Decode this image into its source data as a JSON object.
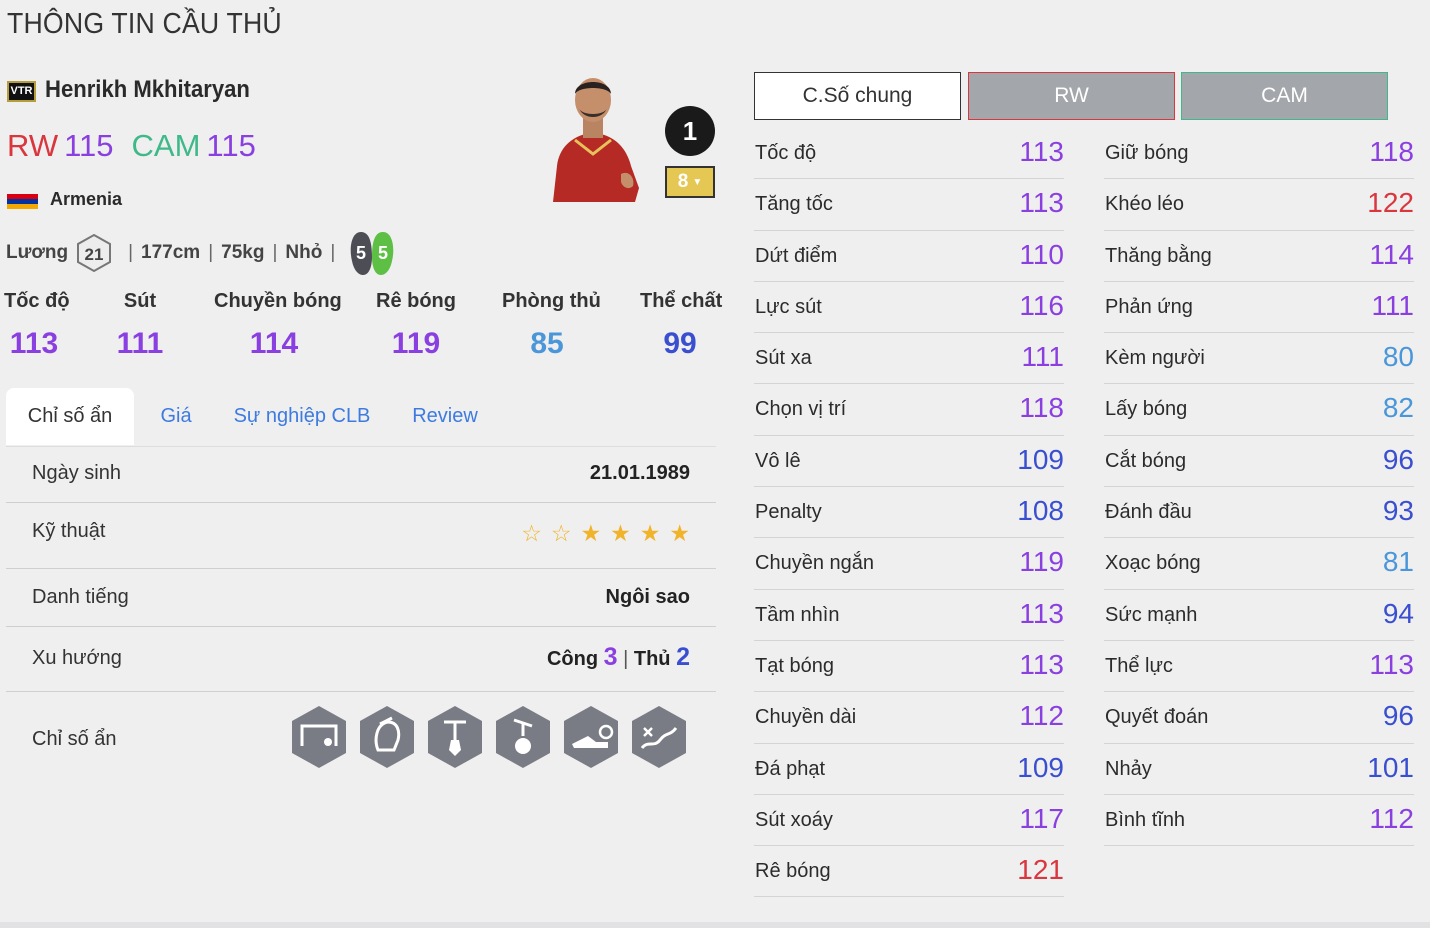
{
  "page": {
    "title": "THÔNG TIN CẦU THỦ"
  },
  "player": {
    "season": "VTR",
    "name": "Henrikh Mkhitaryan",
    "positions": [
      {
        "pos": "RW",
        "ovr": "115",
        "color": "#d9363e"
      },
      {
        "pos": "CAM",
        "ovr": "115",
        "color": "#3fb98a"
      }
    ],
    "nation": "Armenia",
    "salary_label": "Lương",
    "salary": "21",
    "height": "177cm",
    "weight": "75kg",
    "body_type": "Nhỏ",
    "left_foot": "5",
    "right_foot": "5",
    "rank": "1",
    "upgrade_level": "8"
  },
  "summary": [
    {
      "label": "Tốc độ",
      "value": "113",
      "color": "#8a3fe0"
    },
    {
      "label": "Sút",
      "value": "111",
      "color": "#8a3fe0"
    },
    {
      "label": "Chuyền bóng",
      "value": "114",
      "color": "#8a3fe0"
    },
    {
      "label": "Rê bóng",
      "value": "119",
      "color": "#8a3fe0"
    },
    {
      "label": "Phòng thủ",
      "value": "85",
      "color": "#4a96d8"
    },
    {
      "label": "Thể chất",
      "value": "99",
      "color": "#3a4fd0"
    }
  ],
  "tabs": [
    "Chỉ số ẩn",
    "Giá",
    "Sự nghiệp CLB",
    "Review"
  ],
  "details": {
    "birth_label": "Ngày sinh",
    "birth_value": "21.01.1989",
    "skill_label": "Kỹ thuật",
    "skill_stars": 4,
    "reputation_label": "Danh tiếng",
    "reputation_value": "Ngôi sao",
    "work_rate_label": "Xu hướng",
    "attack_label": "Công",
    "attack_value": "3",
    "defense_label": "Thủ",
    "defense_value": "2",
    "traits_label": "Chỉ số ẩn",
    "traits": [
      "goal-trait-icon",
      "gladiator-helmet-trait-icon",
      "tie-trait-icon",
      "puppet-ball-trait-icon",
      "boot-trait-icon",
      "route-arrows-trait-icon"
    ]
  },
  "position_buttons": [
    "C.Số chung",
    "RW",
    "CAM"
  ],
  "stats_left": [
    {
      "label": "Tốc độ",
      "value": "113",
      "color": "#8a3fe0"
    },
    {
      "label": "Tăng tốc",
      "value": "113",
      "color": "#8a3fe0"
    },
    {
      "label": "Dứt điểm",
      "value": "110",
      "color": "#8a3fe0"
    },
    {
      "label": "Lực sút",
      "value": "116",
      "color": "#8a3fe0"
    },
    {
      "label": "Sút xa",
      "value": "111",
      "color": "#8a3fe0"
    },
    {
      "label": "Chọn vị trí",
      "value": "118",
      "color": "#8a3fe0"
    },
    {
      "label": "Vô lê",
      "value": "109",
      "color": "#3a4fd0"
    },
    {
      "label": "Penalty",
      "value": "108",
      "color": "#3a4fd0"
    },
    {
      "label": "Chuyền ngắn",
      "value": "119",
      "color": "#8a3fe0"
    },
    {
      "label": "Tầm nhìn",
      "value": "113",
      "color": "#8a3fe0"
    },
    {
      "label": "Tạt bóng",
      "value": "113",
      "color": "#8a3fe0"
    },
    {
      "label": "Chuyền dài",
      "value": "112",
      "color": "#8a3fe0"
    },
    {
      "label": "Đá phạt",
      "value": "109",
      "color": "#3a4fd0"
    },
    {
      "label": "Sút xoáy",
      "value": "117",
      "color": "#8a3fe0"
    },
    {
      "label": "Rê bóng",
      "value": "121",
      "color": "#d9363e"
    }
  ],
  "stats_right": [
    {
      "label": "Giữ bóng",
      "value": "118",
      "color": "#8a3fe0"
    },
    {
      "label": "Khéo léo",
      "value": "122",
      "color": "#d9363e"
    },
    {
      "label": "Thăng bằng",
      "value": "114",
      "color": "#8a3fe0"
    },
    {
      "label": "Phản ứng",
      "value": "111",
      "color": "#8a3fe0"
    },
    {
      "label": "Kèm người",
      "value": "80",
      "color": "#4a96d8"
    },
    {
      "label": "Lấy bóng",
      "value": "82",
      "color": "#4a96d8"
    },
    {
      "label": "Cắt bóng",
      "value": "96",
      "color": "#3a4fd0"
    },
    {
      "label": "Đánh đầu",
      "value": "93",
      "color": "#3a4fd0"
    },
    {
      "label": "Xoạc bóng",
      "value": "81",
      "color": "#4a96d8"
    },
    {
      "label": "Sức mạnh",
      "value": "94",
      "color": "#3a4fd0"
    },
    {
      "label": "Thể lực",
      "value": "113",
      "color": "#8a3fe0"
    },
    {
      "label": "Quyết đoán",
      "value": "96",
      "color": "#3a4fd0"
    },
    {
      "label": "Nhảy",
      "value": "101",
      "color": "#3a4fd0"
    },
    {
      "label": "Bình tĩnh",
      "value": "112",
      "color": "#8a3fe0"
    }
  ]
}
